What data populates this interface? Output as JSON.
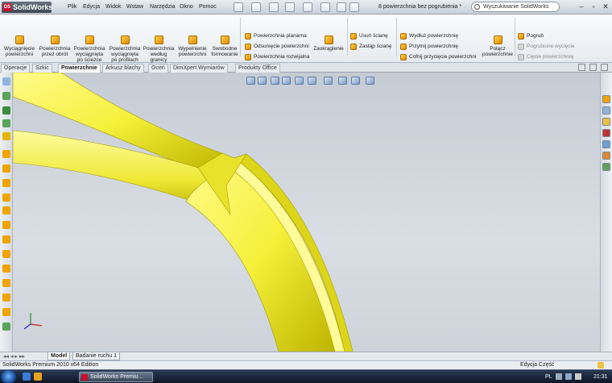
{
  "app": {
    "logo_text": "SolidWorks",
    "doc_title": "8 powierzchnia bez pogrubienia *"
  },
  "menu": [
    "Plik",
    "Edycja",
    "Widok",
    "Wstaw",
    "Narzędzia",
    "Okno",
    "Pomoc"
  ],
  "search": {
    "placeholder": "Wyszukiwanie SolidWorks"
  },
  "window_buttons": {
    "minimize": "–",
    "restore": "▫",
    "close": "✕"
  },
  "ribbon": {
    "big": [
      {
        "label": "Wyciągnięcie powierzchni"
      },
      {
        "label": "Powierzchnia przez obrót"
      },
      {
        "label": "Powierzchnia wyciągnięta po ścieżce"
      },
      {
        "label": "Powierzchnia wyciągnięta po profilach"
      },
      {
        "label": "Powierzchnia według granicy"
      },
      {
        "label": "Wypełnienie powierzchni"
      },
      {
        "label": "Swobodne formowanie"
      }
    ],
    "col1": [
      "Powierzchnia planarna",
      "Odsunięcie powierzchni",
      "Powierzchnia rozwijalna"
    ],
    "zaokraglenie": "Zaokrąglenie",
    "col2": [
      "Usuń ścianę",
      "Zastąp ścianę"
    ],
    "col3": [
      "Wydłuż powierzchnię",
      "Przytnij powierzchnię",
      "Cofnij przycięcie powierzchni"
    ],
    "polacz": "Połącz powierzchnie",
    "col4": [
      {
        "label": "Pogrub",
        "disabled": false
      },
      {
        "label": "Pogrubione wycięcie",
        "disabled": true
      },
      {
        "label": "Cięcie powierzchnią",
        "disabled": true
      }
    ]
  },
  "tabs": [
    {
      "label": "Operacje",
      "active": false
    },
    {
      "label": "Szkic",
      "active": false
    },
    {
      "label": "Powierzchnie",
      "active": true
    },
    {
      "label": "Arkusz blachy",
      "active": false
    },
    {
      "label": "Oceń",
      "active": false
    },
    {
      "label": "DimXpert Wymiarów",
      "active": false
    },
    {
      "label": "Produkty Office",
      "active": false
    }
  ],
  "model_tabs": [
    {
      "label": "Model",
      "active": true
    },
    {
      "label": "Badanie ruchu 1",
      "active": false
    }
  ],
  "status": {
    "left": "SolidWorks Premium 2010 x64 Edition",
    "mode": "Edycja Część"
  },
  "taskbar": {
    "task_label": "SolidWorks Premiu...",
    "lang": "PL",
    "time": "21:31"
  },
  "colors": {
    "part_yellow": "#f5f03a",
    "part_shadow": "#bdb400",
    "bg": "#cfd6de",
    "accent": "#1b4e9c"
  }
}
